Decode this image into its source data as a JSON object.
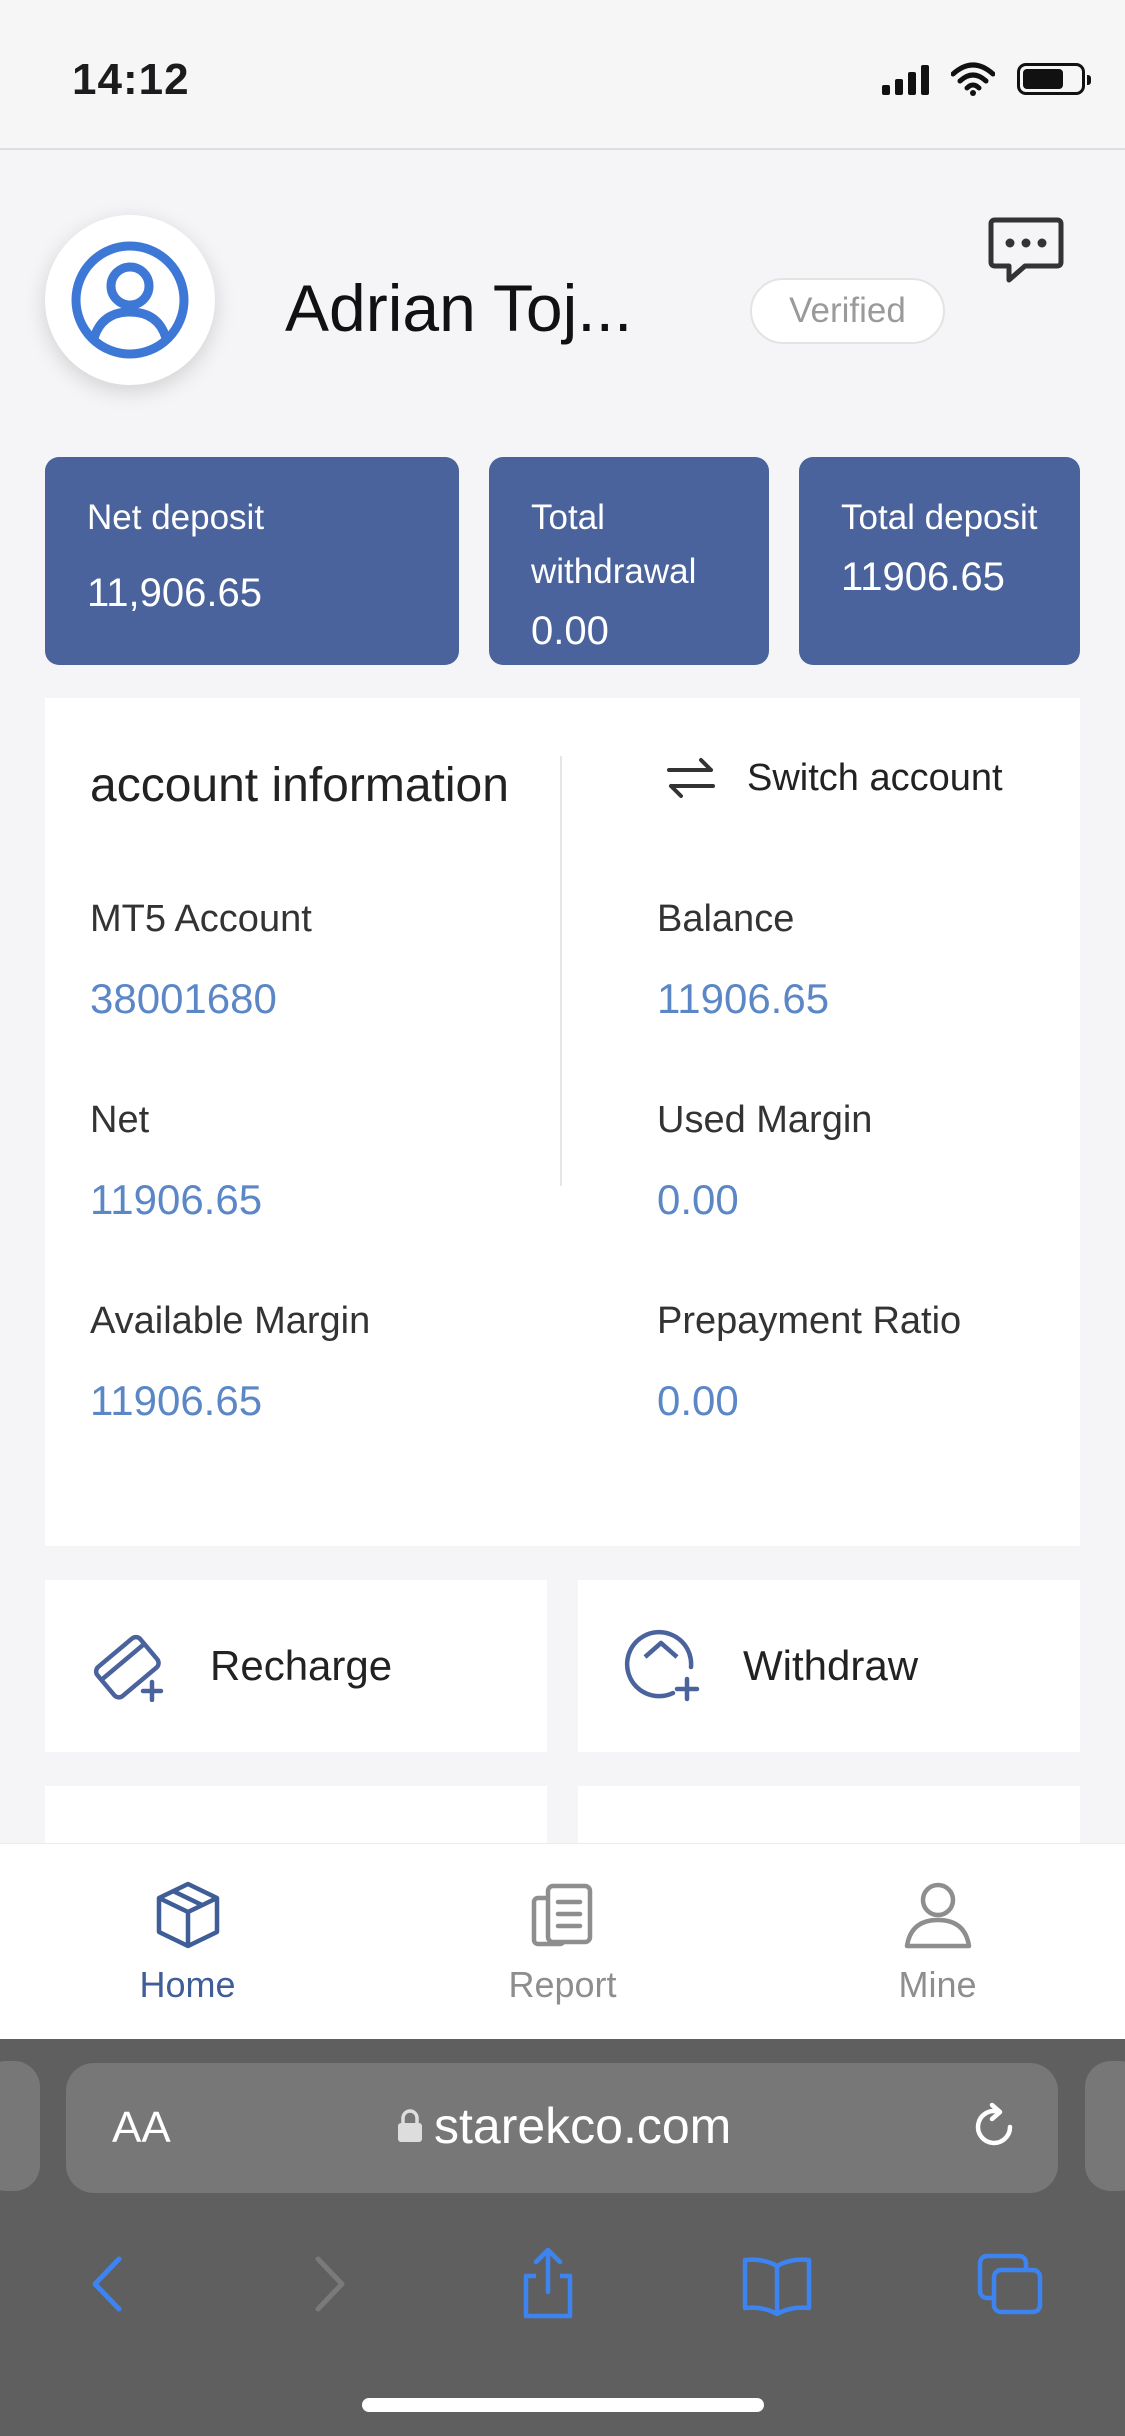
{
  "status_bar": {
    "time": "14:12",
    "battery_level": 0.72
  },
  "profile": {
    "name": "Adrian Toj...",
    "verified_badge": "Verified"
  },
  "stats": [
    {
      "label": "Net deposit",
      "value": "11,906.65"
    },
    {
      "label": "Total withdrawal",
      "value": "0.00"
    },
    {
      "label": "Total deposit",
      "value": "11906.65"
    }
  ],
  "account": {
    "title": "account information",
    "switch_label": "Switch account",
    "fields": [
      {
        "label": "MT5 Account",
        "value": "38001680"
      },
      {
        "label": "Balance",
        "value": "11906.65"
      },
      {
        "label": "Net",
        "value": "11906.65"
      },
      {
        "label": "Used Margin",
        "value": "0.00"
      },
      {
        "label": "Available Margin",
        "value": "11906.65"
      },
      {
        "label": "Prepayment Ratio",
        "value": "0.00"
      }
    ]
  },
  "actions": [
    {
      "label": "Recharge",
      "icon": "card-add-icon"
    },
    {
      "label": "Withdraw",
      "icon": "wallet-add-icon"
    }
  ],
  "tabs": [
    {
      "label": "Home",
      "icon": "cube-icon",
      "active": true
    },
    {
      "label": "Report",
      "icon": "document-icon",
      "active": false
    },
    {
      "label": "Mine",
      "icon": "person-icon",
      "active": false
    }
  ],
  "browser": {
    "text_size_label": "AA",
    "url": "starekco.com"
  },
  "colors": {
    "accent": "#4a639c",
    "value_blue": "#5b87c6",
    "tab_active": "#3f5d97"
  }
}
